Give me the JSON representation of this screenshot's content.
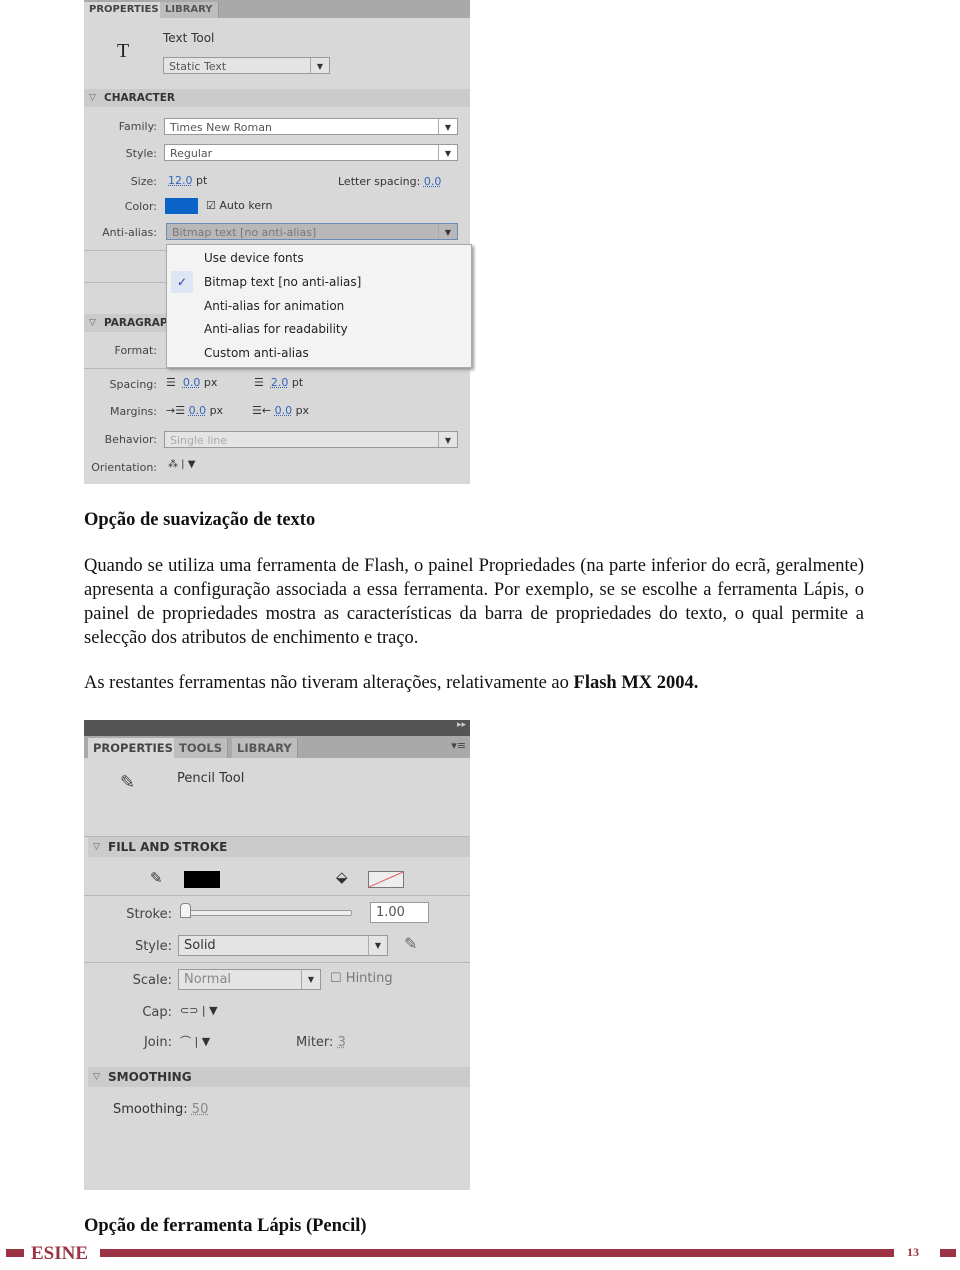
{
  "panel1": {
    "tabs": [
      "PROPERTIES",
      "LIBRARY"
    ],
    "tool_name": "Text Tool",
    "tool_icon": "text-tool-icon",
    "text_type": "Static Text",
    "character": {
      "title": "CHARACTER",
      "family_label": "Family:",
      "family": "Times New Roman",
      "style_label": "Style:",
      "style": "Regular",
      "size_label": "Size:",
      "size": "12.0",
      "size_unit": "pt",
      "letter_spacing_label": "Letter spacing:",
      "letter_spacing": "0.0",
      "color_label": "Color:",
      "color": "#0a64c8",
      "auto_kern": "Auto kern",
      "auto_kern_checked": true,
      "antialias_label": "Anti-alias:",
      "antialias": "Bitmap text [no anti-alias]"
    },
    "menu": {
      "items": [
        "Use device fonts",
        "Bitmap text [no anti-alias]",
        "Anti-alias for animation",
        "Anti-alias for readability",
        "Custom anti-alias"
      ],
      "checked_index": 1
    },
    "paragraph": {
      "title": "PARAGRAP",
      "format_label": "Format:",
      "spacing_label": "Spacing:",
      "spacing1": "0.0",
      "spacing1_unit": "px",
      "spacing2": "2.0",
      "spacing2_unit": "pt",
      "margins_label": "Margins:",
      "margin1": "0.0",
      "margin1_unit": "px",
      "margin2": "0.0",
      "margin2_unit": "px",
      "behavior_label": "Behavior:",
      "behavior": "Single line",
      "orientation_label": "Orientation:"
    }
  },
  "caption1": "Opção de suavização de texto",
  "para1": "Quando se utiliza uma ferramenta de Flash, o painel Propriedades (na parte inferior do ecrã, geralmente) apresenta a configuração associada a essa ferramenta. Por exemplo, se se escolhe a ferramenta Lápis, o painel de propriedades mostra as características da barra de propriedades do texto, o qual permite a selecção dos atributos de enchimento e traço.",
  "para2_text": "As restantes ferramentas não tiveram alterações, relativamente ao ",
  "para2_bold": "Flash MX 2004.",
  "panel2": {
    "tabs": [
      "PROPERTIES",
      "TOOLS",
      "LIBRARY"
    ],
    "tool_name": "Pencil Tool",
    "fill_stroke": {
      "title": "FILL AND STROKE",
      "stroke_color": "#000000",
      "stroke_label": "Stroke:",
      "stroke_value": "1.00",
      "stroke_slider_fraction": 0,
      "style_label": "Style:",
      "style": "Solid",
      "scale_label": "Scale:",
      "scale": "Normal",
      "hinting": "Hinting",
      "hinting_checked": false,
      "cap_label": "Cap:",
      "join_label": "Join:",
      "miter_label": "Miter:",
      "miter": "3"
    },
    "smoothing": {
      "title": "SMOOTHING",
      "label": "Smoothing:",
      "value": "50"
    }
  },
  "caption2": "Opção de ferramenta Lápis (Pencil)",
  "footer": {
    "brand": "ESINE",
    "page": "13",
    "color": "#9b3344"
  }
}
